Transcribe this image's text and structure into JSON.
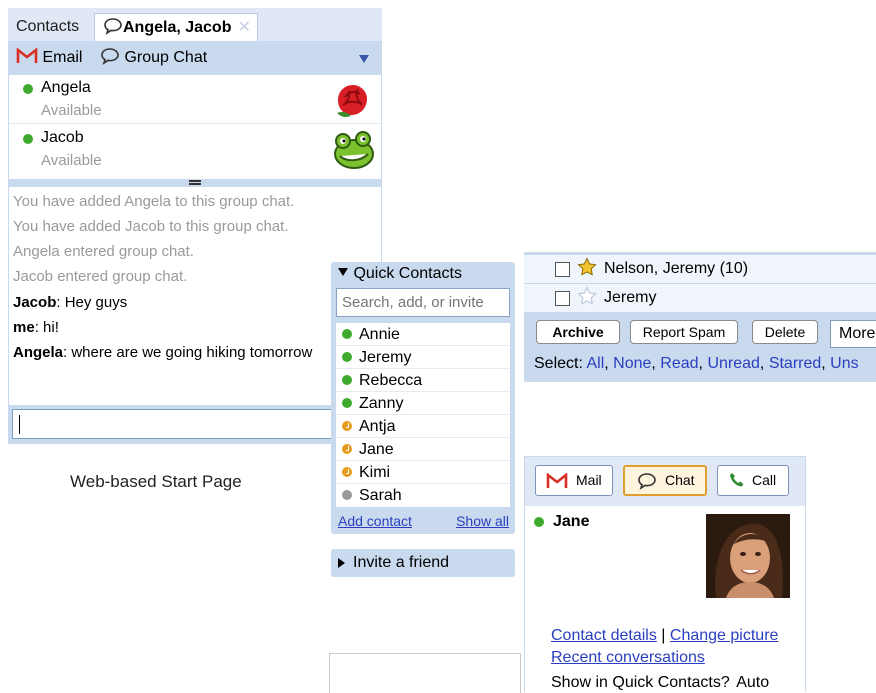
{
  "group_chat": {
    "tabs": {
      "contacts": "Contacts",
      "active": "Angela, Jacob"
    },
    "toolbar": {
      "email": "Email",
      "group_chat": "Group Chat"
    },
    "members": [
      {
        "name": "Angela",
        "status": "Available"
      },
      {
        "name": "Jacob",
        "status": "Available"
      }
    ],
    "log": {
      "sys1": "You have added Angela to this group chat.",
      "sys2": "You have added Jacob to this group chat.",
      "sys3": "Angela entered group chat.",
      "sys4": "Jacob entered group chat.",
      "m1_sender": "Jacob",
      "m1_text": ": Hey guys",
      "m2_sender": "me",
      "m2_text": ": hi!",
      "m3_sender": "Angela",
      "m3_text": ": where are we going hiking tomorrow"
    }
  },
  "caption": "Web-based Start Page",
  "quick_contacts": {
    "title": "Quick Contacts",
    "search_placeholder": "Search, add, or invite",
    "contacts": [
      {
        "name": "Annie",
        "status": "available"
      },
      {
        "name": "Jeremy",
        "status": "available"
      },
      {
        "name": "Rebecca",
        "status": "available"
      },
      {
        "name": "Zanny",
        "status": "available"
      },
      {
        "name": "Antja",
        "status": "idle"
      },
      {
        "name": "Jane",
        "status": "idle"
      },
      {
        "name": "Kimi",
        "status": "idle"
      },
      {
        "name": "Sarah",
        "status": "offline"
      }
    ],
    "add_contact": "Add contact",
    "show_all": "Show all"
  },
  "invite": {
    "label": "Invite a friend"
  },
  "mail": {
    "rows": [
      {
        "subject": "Nelson, Jeremy (10)",
        "starred": true
      },
      {
        "subject": "Jeremy",
        "starred": false
      }
    ],
    "buttons": {
      "archive": "Archive",
      "spam": "Report Spam",
      "delete": "Delete",
      "more": "More"
    },
    "select_label": "Select:",
    "select": {
      "all": "All",
      "none": "None",
      "read": "Read",
      "unread": "Unread",
      "starred": "Starred",
      "unstarred": "Uns"
    }
  },
  "contact_card": {
    "buttons": {
      "mail": "Mail",
      "chat": "Chat",
      "call": "Call"
    },
    "name": "Jane",
    "contact_details": "Contact details",
    "separator": "|",
    "change_picture": "Change picture",
    "recent": "Recent conversations",
    "show_in_qc": "Show in Quick Contacts?",
    "show_value": "Auto"
  },
  "colors": {
    "panel_blue": "#c9d9ee",
    "available": "#3daa2c",
    "idle": "#e89a1c",
    "offline": "#999999",
    "link": "#2a3fbf",
    "chat_button_border": "#e0a030"
  }
}
